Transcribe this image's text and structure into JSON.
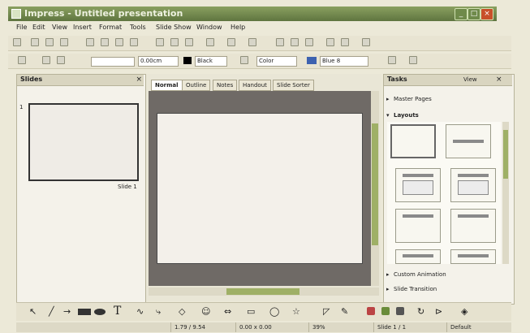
{
  "window": {
    "title": "Impress - Untitled presentation"
  },
  "menubar": {
    "items": [
      "File",
      "Edit",
      "View",
      "Insert",
      "Format",
      "Tools",
      "Slide Show",
      "Window",
      "Help"
    ]
  },
  "toolbar": {
    "line_width": "0.00cm",
    "line_color": "Black",
    "fill_style": "Color",
    "fill_color": "Blue 8"
  },
  "slides_pane": {
    "title": "Slides",
    "slide_label": "Slide 1",
    "slide_number": "1"
  },
  "editor": {
    "tabs": [
      "Normal",
      "Outline",
      "Notes",
      "Handout",
      "Slide Sorter"
    ],
    "active_tab": "Normal"
  },
  "tasks_pane": {
    "title": "Tasks",
    "view_label": "View",
    "sections": {
      "master_pages": "Master Pages",
      "layouts": "Layouts",
      "custom_animation": "Custom Animation",
      "slide_transition": "Slide Transition"
    }
  },
  "statusbar": {
    "position": "1.79 / 9.54",
    "size": "0.00 x 0.00",
    "zoom": "39%",
    "slide": "Slide 1 / 1",
    "layout": "Default"
  },
  "icons": [
    "new-icon",
    "open-icon",
    "save-icon",
    "print-icon",
    "cut-icon",
    "copy-icon",
    "paste-icon",
    "undo-icon",
    "redo-icon",
    "select-icon",
    "line-icon",
    "arrow-icon",
    "rectangle-icon",
    "ellipse-icon",
    "text-icon",
    "star-icon"
  ]
}
